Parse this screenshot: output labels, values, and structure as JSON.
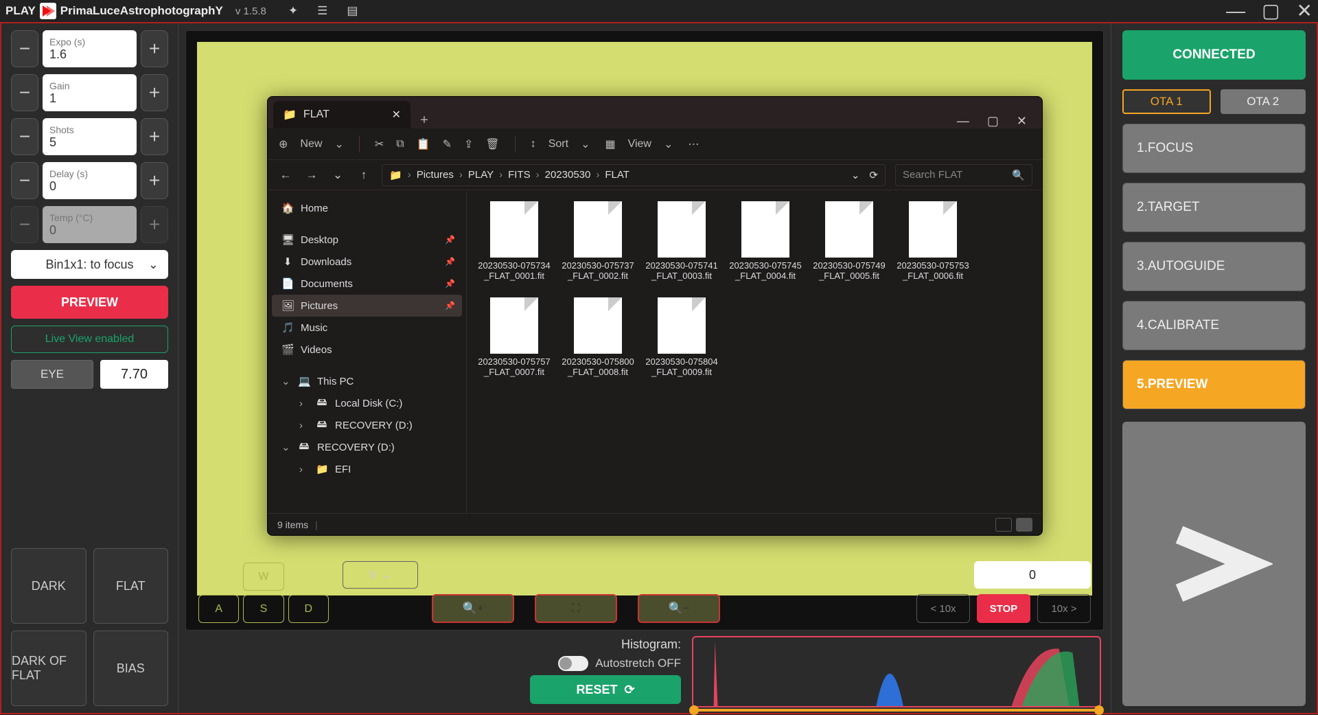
{
  "app": {
    "name": "PLAY",
    "brand": "PrimaLuceAstrophotographY",
    "version": "v 1.5.8"
  },
  "left": {
    "expo": {
      "label": "Expo (s)",
      "value": "1.6"
    },
    "gain": {
      "label": "Gain",
      "value": "1"
    },
    "shots": {
      "label": "Shots",
      "value": "5"
    },
    "delay": {
      "label": "Delay (s)",
      "value": "0"
    },
    "temp": {
      "label": "Temp (°C)",
      "value": "0"
    },
    "binning": "Bin1x1: to focus",
    "preview_btn": "PREVIEW",
    "live_view": "Live View enabled",
    "eye_label": "EYE",
    "eye_value": "7.70",
    "frames": {
      "dark": "DARK",
      "flat": "FLAT",
      "darkflat": "DARK OF FLAT",
      "bias": "BIAS"
    }
  },
  "center": {
    "wasd": {
      "w": "W",
      "a": "A",
      "s": "S",
      "d": "D"
    },
    "speed": "9",
    "stop_value": "0",
    "back10": "< 10x",
    "stop": "STOP",
    "fwd10": "10x >",
    "histogram_label": "Histogram:",
    "autostretch": "Autostretch OFF",
    "reset": "RESET"
  },
  "right": {
    "connected": "CONNECTED",
    "ota1": "OTA 1",
    "ota2": "OTA 2",
    "steps": [
      "1.FOCUS",
      "2.TARGET",
      "3.AUTOGUIDE",
      "4.CALIBRATE",
      "5.PREVIEW"
    ]
  },
  "explorer": {
    "tab_title": "FLAT",
    "new_label": "New",
    "sort_label": "Sort",
    "view_label": "View",
    "breadcrumbs": [
      "Pictures",
      "PLAY",
      "FITS",
      "20230530",
      "FLAT"
    ],
    "search_placeholder": "Search FLAT",
    "nav": {
      "home": "Home",
      "quick": [
        "Desktop",
        "Downloads",
        "Documents",
        "Pictures",
        "Music",
        "Videos"
      ],
      "thispc": "This PC",
      "drives": [
        "Local Disk (C:)",
        "RECOVERY (D:)"
      ],
      "recovery": "RECOVERY (D:)",
      "efi": "EFI"
    },
    "files": [
      "20230530-075734_FLAT_0001.fit",
      "20230530-075737_FLAT_0002.fit",
      "20230530-075741_FLAT_0003.fit",
      "20230530-075745_FLAT_0004.fit",
      "20230530-075749_FLAT_0005.fit",
      "20230530-075753_FLAT_0006.fit",
      "20230530-075757_FLAT_0007.fit",
      "20230530-075800_FLAT_0008.fit",
      "20230530-075804_FLAT_0009.fit"
    ],
    "status": "9 items"
  }
}
